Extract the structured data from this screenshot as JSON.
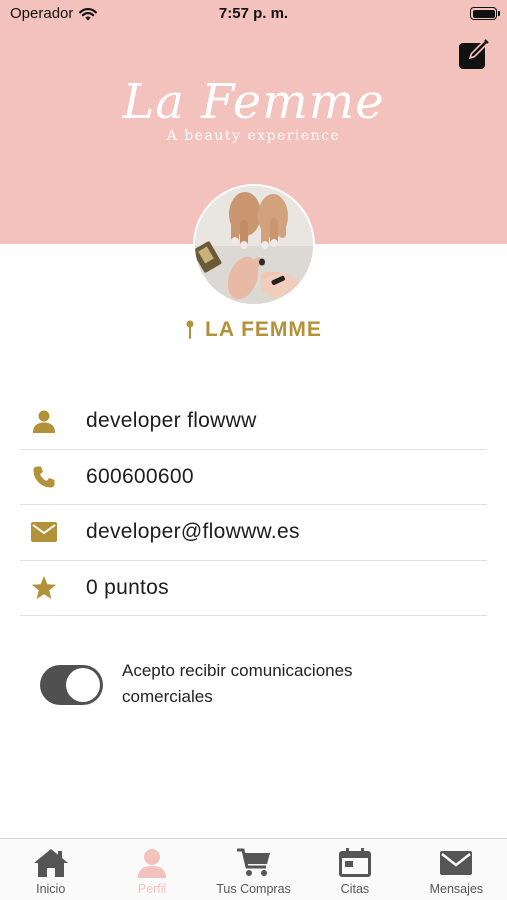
{
  "status_bar": {
    "carrier": "Operador",
    "time": "7:57 p. m."
  },
  "header": {
    "logo_title": "La Femme",
    "logo_subtitle": "A beauty experience",
    "background_color": "#f4c2bd"
  },
  "profile": {
    "brand_name": "LA FEMME",
    "accent_color": "#b39138",
    "name": "developer flowww",
    "phone": "600600600",
    "email": "developer@flowww.es",
    "points": "0 puntos"
  },
  "consent": {
    "label": "Acepto recibir comunicaciones comerciales",
    "enabled": true
  },
  "tabs": [
    {
      "label": "Inicio",
      "icon": "home-icon"
    },
    {
      "label": "Perfil",
      "icon": "person-icon",
      "active": true
    },
    {
      "label": "Tus Compras",
      "icon": "cart-icon"
    },
    {
      "label": "Citas",
      "icon": "calendar-icon"
    },
    {
      "label": "Mensajes",
      "icon": "mail-icon"
    }
  ]
}
